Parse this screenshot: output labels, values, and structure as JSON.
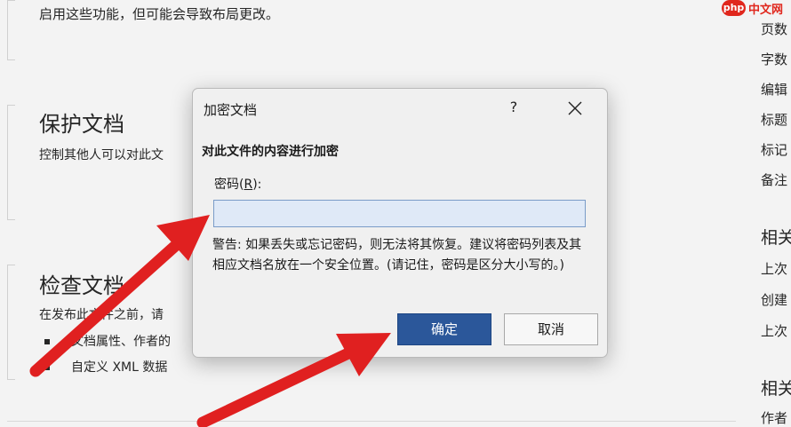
{
  "background": {
    "top_text": "启用这些功能，但可能会导致布局更改。",
    "protect": {
      "heading": "保护文档",
      "description": "控制其他人可以对此文"
    },
    "inspect": {
      "heading": "检查文档",
      "description": "在发布此文件之前，请",
      "bullets": [
        "文档属性、作者的",
        "自定义 XML 数据"
      ]
    },
    "right_column": {
      "items": [
        "页数",
        "字数",
        "编辑",
        "标题",
        "标记",
        "备注"
      ],
      "heading1": "相关",
      "items2": [
        "上次",
        "创建",
        "上次"
      ],
      "heading2": "相关",
      "items3": [
        "作者"
      ]
    }
  },
  "watermark": {
    "logo": "php",
    "text": "中文网"
  },
  "dialog": {
    "title": "加密文档",
    "help_label": "?",
    "heading": "对此文件的内容进行加密",
    "password_label": "密码(",
    "password_accesskey": "R",
    "password_label_end": "):",
    "password_value": "",
    "warning": "警告: 如果丢失或忘记密码，则无法将其恢复。建议将密码列表及其相应文档名放在一个安全位置。(请记住，密码是区分大小写的。)",
    "ok_label": "确定",
    "cancel_label": "取消"
  },
  "colors": {
    "accent_button": "#2b579a",
    "annotation_arrow": "#e02020",
    "input_background": "#dfe9f7"
  }
}
